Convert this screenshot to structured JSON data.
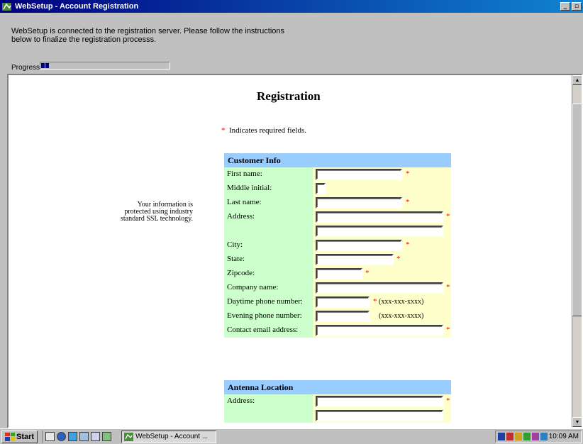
{
  "window": {
    "title": "WebSetup - Account Registration",
    "controls": [
      "minimize",
      "maximize"
    ]
  },
  "header": {
    "instructions": "WebSetup is connected to the registration server. Please follow the instructions below to finalize the registration processs.",
    "progress_label": "Progress:",
    "progress_value": 0.06
  },
  "page": {
    "title": "Registration",
    "required_marker": "*",
    "required_note": "Indicates required fields.",
    "ssl_note": "Your information is protected using industry standard SSL technology."
  },
  "customer_info": {
    "header": "Customer Info",
    "fields": [
      {
        "label": "First name:",
        "value": "",
        "required": true
      },
      {
        "label": "Middle initial:",
        "value": "",
        "required": false
      },
      {
        "label": "Last name:",
        "value": "",
        "required": true
      },
      {
        "label": "Address:",
        "value": "",
        "required": true
      },
      {
        "label": "",
        "value": "",
        "required": false
      },
      {
        "label": "City:",
        "value": "",
        "required": true
      },
      {
        "label": "State:",
        "value": "",
        "required": true
      },
      {
        "label": "Zipcode:",
        "value": "",
        "required": true
      },
      {
        "label": "Company name:",
        "value": "",
        "required": true
      },
      {
        "label": "Daytime phone number:",
        "value": "",
        "required": true,
        "hint": "(xxx-xxx-xxxx)"
      },
      {
        "label": "Evening phone number:",
        "value": "",
        "required": false,
        "hint": "(xxx-xxx-xxxx)"
      },
      {
        "label": "Contact email address:",
        "value": "",
        "required": true
      }
    ]
  },
  "antenna_location": {
    "header": "Antenna Location",
    "fields": [
      {
        "label": "Address:",
        "value": "",
        "required": true
      },
      {
        "label": "",
        "value": "",
        "required": false
      }
    ]
  },
  "taskbar": {
    "start_label": "Start",
    "task_label": "WebSetup - Account ...",
    "clock": "10:09 AM"
  },
  "colors": {
    "title_bar": "#000080",
    "section_header": "#99ccff",
    "label_cell": "#ccffcc",
    "field_cell": "#ffffcc",
    "required": "#ff0000"
  }
}
